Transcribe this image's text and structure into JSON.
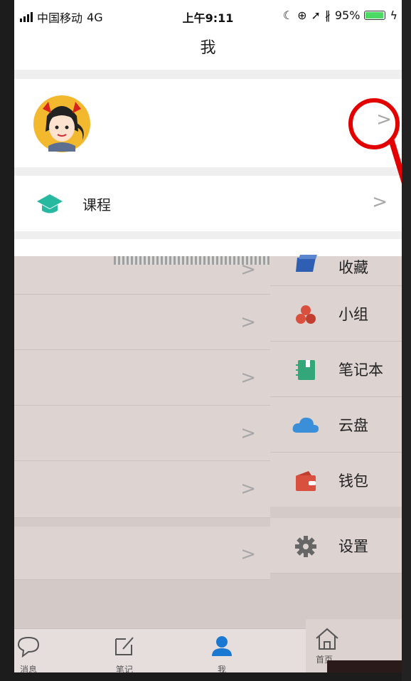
{
  "status": {
    "carrier": "中国移动",
    "network": "4G",
    "time": "上午9:11",
    "battery": "95%",
    "battery_level": 0.95
  },
  "nav": {
    "title": "我"
  },
  "profile": {
    "chevron": ">"
  },
  "menu": {
    "course": "课程",
    "favorites_peek": "收藏",
    "right_items": [
      {
        "label": "收藏",
        "icon": "favorites-icon",
        "color": "#2e5fb2"
      },
      {
        "label": "小组",
        "icon": "group-icon",
        "color": "#d9503f"
      },
      {
        "label": "笔记本",
        "icon": "notebook-icon",
        "color": "#33a77a"
      },
      {
        "label": "云盘",
        "icon": "cloud-icon",
        "color": "#3b8fd9"
      },
      {
        "label": "钱包",
        "icon": "wallet-icon",
        "color": "#d9503f"
      },
      {
        "label": "设置",
        "icon": "gear-icon",
        "color": "#666666"
      }
    ]
  },
  "tabs": {
    "messages": "消息",
    "notes": "笔记",
    "me": "我",
    "home": "首页"
  },
  "colors": {
    "accent": "#1a78d3",
    "teal": "#26b9a0",
    "annotation": "#e20000"
  }
}
